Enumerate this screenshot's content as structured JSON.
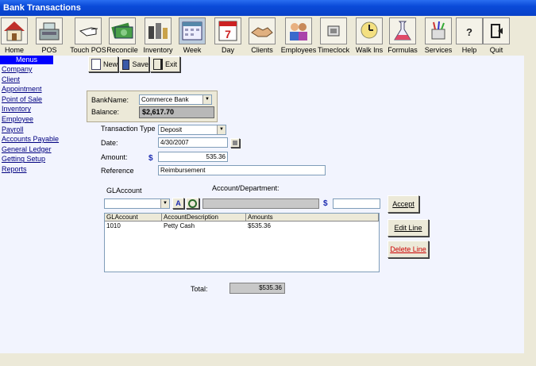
{
  "window": {
    "title": "Bank Transactions"
  },
  "toolbar": [
    {
      "label": "Home",
      "icon": "home-icon"
    },
    {
      "label": "POS",
      "icon": "cash-register-icon"
    },
    {
      "label": "Touch POS",
      "icon": "touch-hand-icon"
    },
    {
      "label": "Reconcile",
      "icon": "money-icon"
    },
    {
      "label": "Inventory",
      "icon": "inventory-icon"
    },
    {
      "label": "Week",
      "icon": "week-calendar-icon"
    },
    {
      "label": "Day",
      "icon": "day-calendar-icon"
    },
    {
      "label": "Clients",
      "icon": "handshake-icon"
    },
    {
      "label": "Employees",
      "icon": "employees-icon"
    },
    {
      "label": "Timeclock",
      "icon": "timeclock-icon"
    },
    {
      "label": "Walk Ins",
      "icon": "walk-ins-icon"
    },
    {
      "label": "Formulas",
      "icon": "flask-icon"
    },
    {
      "label": "Services",
      "icon": "services-icon"
    },
    {
      "label": "Help",
      "icon": "help-icon"
    },
    {
      "label": "Quit",
      "icon": "quit-icon"
    }
  ],
  "sidebar": {
    "header": "Menus",
    "items": [
      "Company",
      "Client",
      "Appointment",
      "Point of Sale",
      "Inventory",
      "Employee",
      "Payroll",
      "Accounts Payable",
      "General Ledger",
      "Getting Setup",
      "Reports"
    ]
  },
  "actions": {
    "new": "New",
    "save": "Save",
    "exit": "Exit"
  },
  "bank": {
    "name_label": "BankName:",
    "name_value": "Commerce Bank",
    "balance_label": "Balance:",
    "balance_value": "$2,617.70"
  },
  "form": {
    "type_label": "Transaction Type",
    "type_value": "Deposit",
    "date_label": "Date:",
    "date_value": "4/30/2007",
    "amount_label": "Amount:",
    "amount_value": "535.36",
    "currency_symbol": "$",
    "reference_label": "Reference",
    "reference_value": "Reimbursement"
  },
  "gl": {
    "glaccount_label": "GLAccount",
    "account_dept_label": "Account/Department:",
    "search_a": "A",
    "currency_symbol": "$"
  },
  "line_buttons": {
    "accept": "Accept",
    "edit": "Edit Line",
    "delete": "Delete Line",
    "delete_color": "#cc0000"
  },
  "grid": {
    "columns": [
      "GLAccount",
      "AccountDescription",
      "Amounts"
    ],
    "rows": [
      [
        "1010",
        "Petty Cash",
        "$535.36"
      ]
    ]
  },
  "total": {
    "label": "Total:",
    "value": "$535.36"
  }
}
